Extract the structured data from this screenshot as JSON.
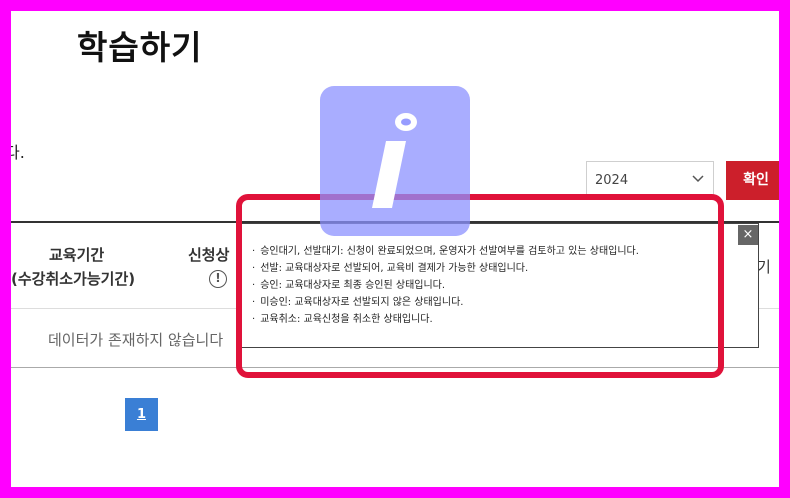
{
  "page": {
    "title": "학습하기",
    "cut_text": "다."
  },
  "filter": {
    "year": "2024",
    "confirm_label": "확인"
  },
  "table": {
    "header_period_line1": "교육기간",
    "header_period_line2": "(수강취소가능기간)",
    "header_status": "신청상",
    "header_right_cut": "기",
    "info_icon": "!",
    "empty_text": "데이터가 존재하지 않습니다"
  },
  "pagination": {
    "current_page": "1"
  },
  "tooltip": {
    "close_label": "×",
    "items": [
      "승인대기, 선발대기: 신청이 완료되었으며, 운영자가 선발여부를 검토하고 있는 상태입니다.",
      "선발: 교육대상자로 선발되어, 교육비 결제가 가능한 상태입니다.",
      "승인: 교육대상자로 최종 승인된 상태입니다.",
      "미승인: 교육대상자로 선발되지 않은 상태입니다.",
      "교육취소: 교육신청을 취소한 상태입니다."
    ]
  },
  "colors": {
    "highlight_border": "#e0123a",
    "confirm_button": "#cc1f2b",
    "page_button": "#3a7fd5",
    "frame": "#ff00ff"
  },
  "icons": {
    "overlay": "info-icon",
    "select": "chevron-down-icon",
    "status_info": "exclamation-circle-icon"
  }
}
